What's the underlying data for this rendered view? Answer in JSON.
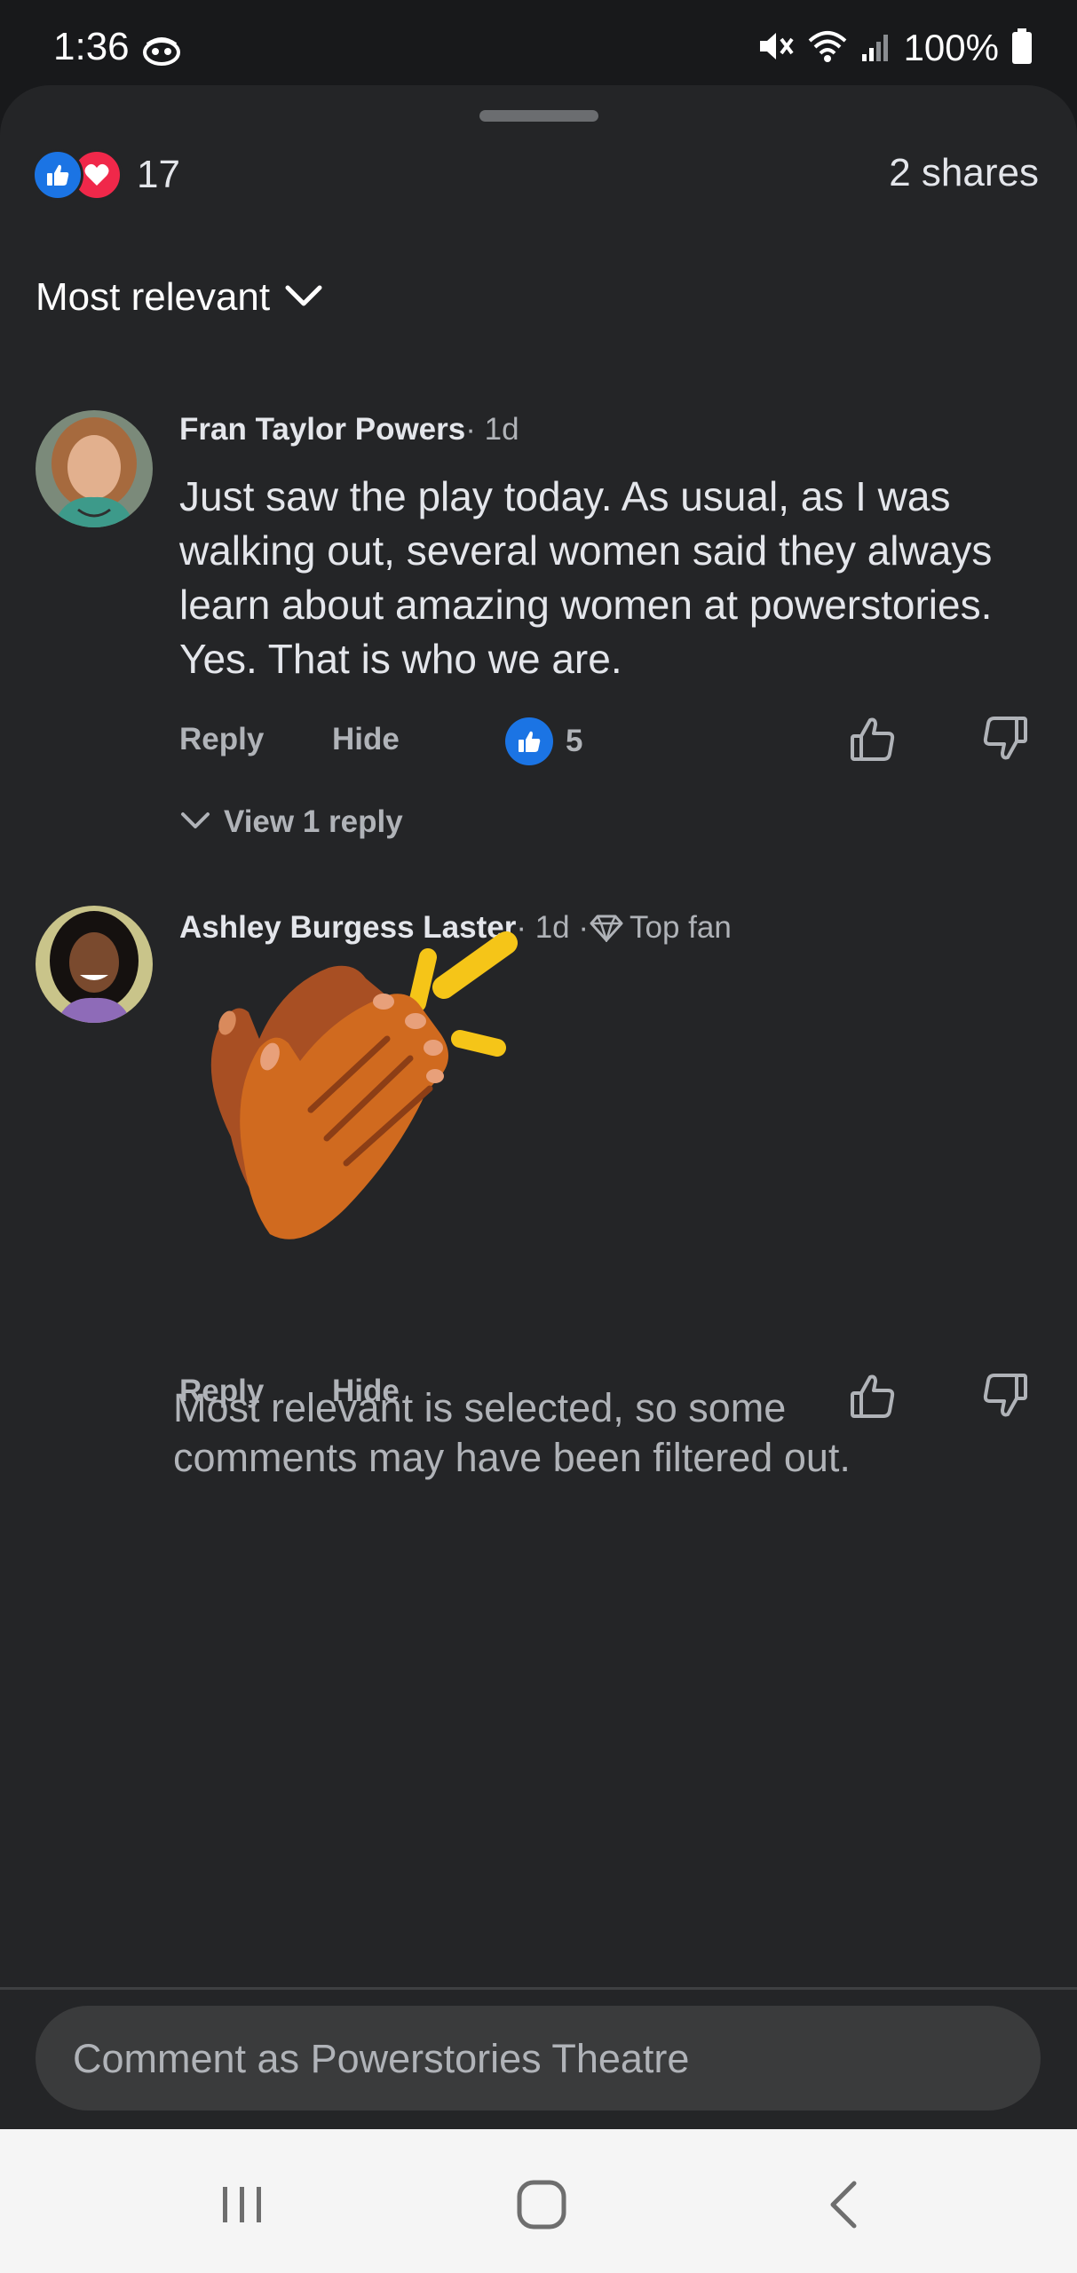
{
  "status_bar": {
    "time": "1:36",
    "battery": "100%",
    "icons": [
      "wave-monster-icon",
      "mute-icon",
      "wifi-icon",
      "signal-icon",
      "battery-icon"
    ]
  },
  "reactions": {
    "count": "17",
    "icons": [
      "like-icon",
      "love-icon"
    ]
  },
  "shares": "2 shares",
  "sort": {
    "label": "Most relevant"
  },
  "comments": [
    {
      "author": "Fran Taylor Powers",
      "meta": " · 1d",
      "text": "Just saw the play today. As usual, as I was walking out, several women said they always learn about amazing women at powerstories. Yes. That is who we are.",
      "reply_label": "Reply",
      "hide_label": "Hide",
      "like_count": "5",
      "view_replies_label": "View 1 reply"
    },
    {
      "author": "Ashley Burgess Laster",
      "meta": " · 1d · ",
      "badge": "Top fan",
      "sticker": "clapping-hands",
      "reply_label": "Reply",
      "hide_label": "Hide"
    }
  ],
  "filter_note": "Most relevant is selected, so some comments may have been filtered out.",
  "composer": {
    "placeholder": "Comment as Powerstories Theatre"
  },
  "colors": {
    "background": "#242527",
    "like_blue": "#1b74e4",
    "love_red": "#f0284a",
    "secondary_text": "#b0b3b8"
  }
}
